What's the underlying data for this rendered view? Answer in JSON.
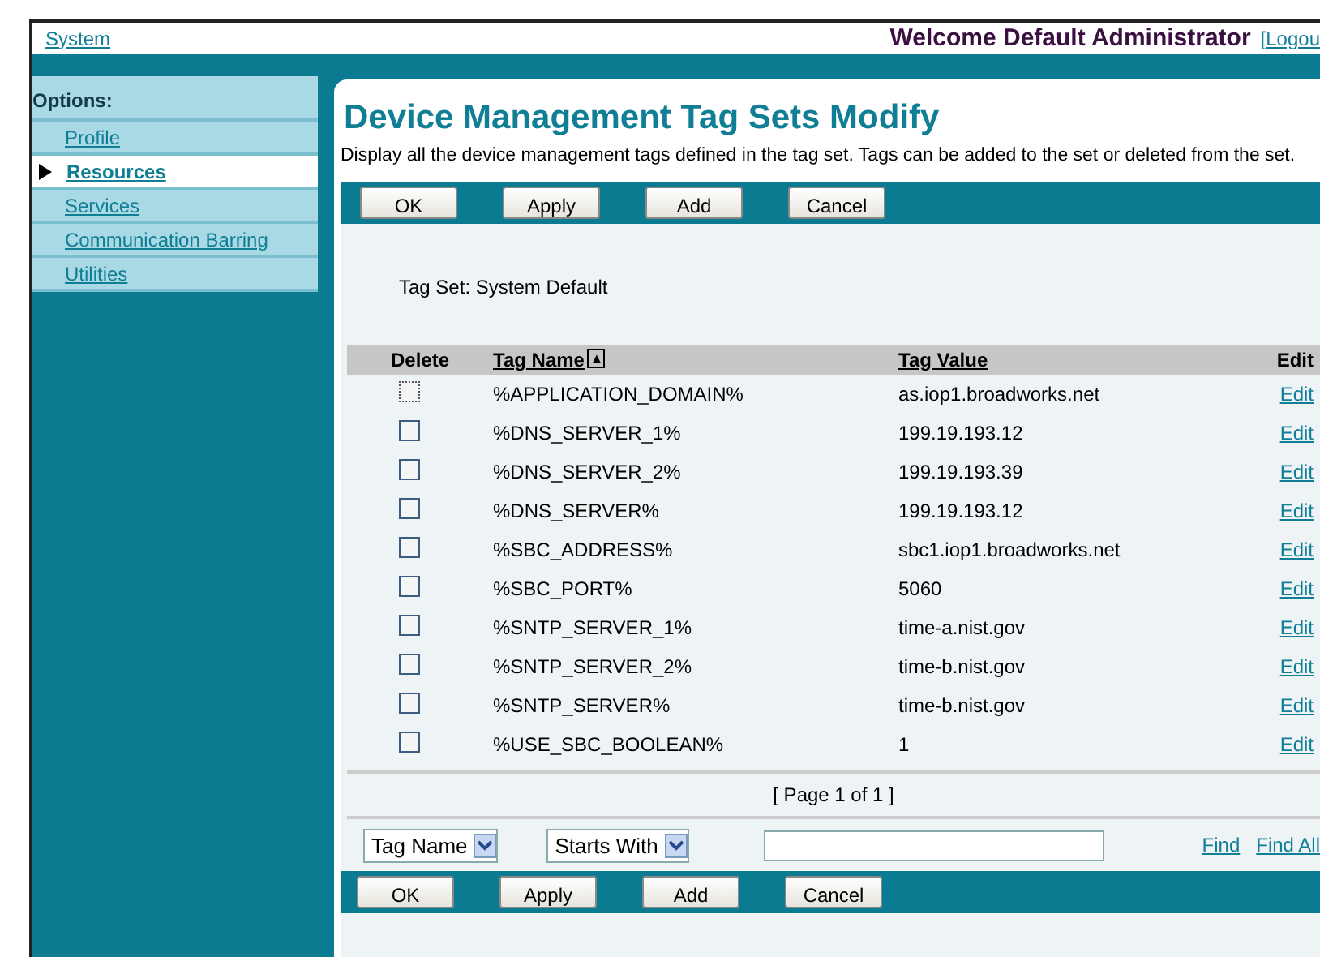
{
  "header": {
    "home_link": "System",
    "welcome": "Welcome Default Administrator",
    "logout": "[Logou"
  },
  "sidebar": {
    "heading": "Options:",
    "items": [
      {
        "label": "Profile",
        "selected": false
      },
      {
        "label": "Resources",
        "selected": true
      },
      {
        "label": "Services",
        "selected": false
      },
      {
        "label": "Communication Barring",
        "selected": false
      },
      {
        "label": "Utilities",
        "selected": false
      }
    ]
  },
  "page": {
    "title": "Device Management Tag Sets Modify",
    "description": "Display all the device management tags defined in the tag set. Tags can be added to the set or deleted from the set.",
    "buttons": [
      "OK",
      "Apply",
      "Add",
      "Cancel"
    ],
    "tag_set": "Tag Set: System Default",
    "columns": [
      "Delete",
      "Tag Name",
      "Tag Value",
      "Edit"
    ],
    "sort_indicator": "▲",
    "rows": [
      {
        "name": "%APPLICATION_DOMAIN%",
        "value": "as.iop1.broadworks.net",
        "edit": "Edit",
        "checked": false,
        "focused": true
      },
      {
        "name": "%DNS_SERVER_1%",
        "value": "199.19.193.12",
        "edit": "Edit",
        "checked": false,
        "focused": false
      },
      {
        "name": "%DNS_SERVER_2%",
        "value": "199.19.193.39",
        "edit": "Edit",
        "checked": false,
        "focused": false
      },
      {
        "name": "%DNS_SERVER%",
        "value": "199.19.193.12",
        "edit": "Edit",
        "checked": false,
        "focused": false
      },
      {
        "name": "%SBC_ADDRESS%",
        "value": "sbc1.iop1.broadworks.net",
        "edit": "Edit",
        "checked": false,
        "focused": false
      },
      {
        "name": "%SBC_PORT%",
        "value": "5060",
        "edit": "Edit",
        "checked": false,
        "focused": false
      },
      {
        "name": "%SNTP_SERVER_1%",
        "value": "time-a.nist.gov",
        "edit": "Edit",
        "checked": false,
        "focused": false
      },
      {
        "name": "%SNTP_SERVER_2%",
        "value": "time-b.nist.gov",
        "edit": "Edit",
        "checked": false,
        "focused": false
      },
      {
        "name": "%SNTP_SERVER%",
        "value": "time-b.nist.gov",
        "edit": "Edit",
        "checked": false,
        "focused": false
      },
      {
        "name": "%USE_SBC_BOOLEAN%",
        "value": "1",
        "edit": "Edit",
        "checked": false,
        "focused": false
      }
    ],
    "pagination": "[ Page 1 of 1 ]",
    "filter": {
      "field": "Tag Name",
      "mode": "Starts With",
      "find": "Find",
      "find_all": "Find All"
    },
    "bottom_buttons": [
      "OK",
      "Apply",
      "Add",
      "Cancel"
    ]
  }
}
